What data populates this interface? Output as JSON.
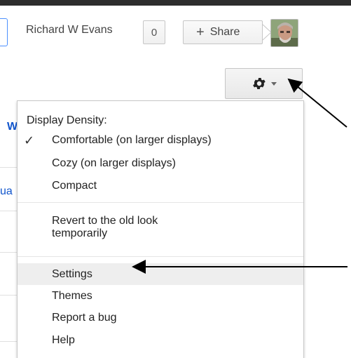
{
  "header": {
    "user_name": "Richard W Evans",
    "notification_count": "0",
    "share_label": "Share",
    "share_plus": "+"
  },
  "left_fragments": {
    "w": "W",
    "ua": "ua"
  },
  "settings_menu": {
    "density_header": "Display Density:",
    "check_mark": "✓",
    "density_options": [
      {
        "label": "Comfortable (on larger displays)",
        "selected": true
      },
      {
        "label": "Cozy (on larger displays)",
        "selected": false
      },
      {
        "label": "Compact",
        "selected": false
      }
    ],
    "revert_line1": "Revert to the old look",
    "revert_line2": "temporarily",
    "items": [
      "Settings",
      "Themes",
      "Report a bug",
      "Help"
    ],
    "highlighted_item": "Settings"
  },
  "icons": {
    "gear": "gear-icon",
    "caret": "chevron-down-icon",
    "avatar": "user-avatar"
  },
  "colors": {
    "top_bar": "#2d2d2d",
    "link_blue": "#1155cc",
    "focus_blue": "#4d90fe",
    "highlight": "#eeeeee"
  }
}
